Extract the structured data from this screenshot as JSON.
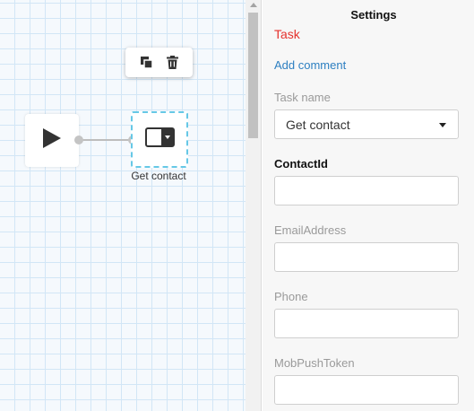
{
  "canvas": {
    "task_node": {
      "label": "Get contact"
    }
  },
  "settings": {
    "title": "Settings",
    "task_type": "Task",
    "add_comment": "Add comment",
    "task_name": {
      "label": "Task name",
      "value": "Get contact"
    },
    "fields": [
      {
        "label": "ContactId",
        "value": ""
      },
      {
        "label": "EmailAddress",
        "value": ""
      },
      {
        "label": "Phone",
        "value": ""
      },
      {
        "label": "MobPushToken",
        "value": ""
      }
    ]
  },
  "colors": {
    "task_type": "#e5322d",
    "link": "#2d7fc1",
    "selection_border": "#66c8e6",
    "grid": "#d2e6f6"
  },
  "icons": {
    "copy": "copy-icon",
    "delete": "trash-icon",
    "start": "play-icon",
    "task": "task-dropdown-icon"
  }
}
